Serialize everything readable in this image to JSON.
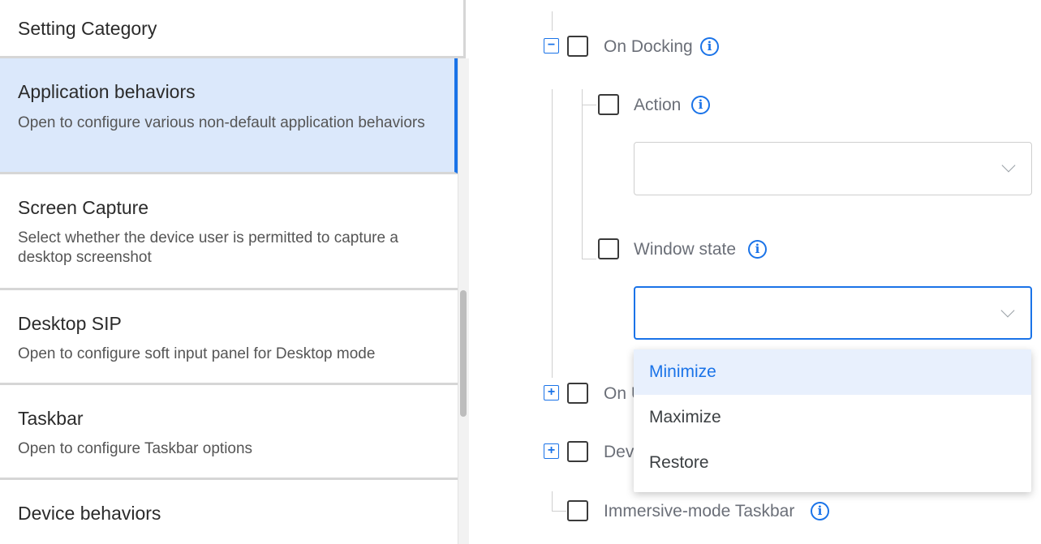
{
  "left_panel": {
    "header": "Setting Category",
    "items": [
      {
        "title": "Application behaviors",
        "description": "Open to configure various non-default application behaviors",
        "selected": true
      },
      {
        "title": "Screen Capture",
        "description": "Select whether the device user is permitted to capture a desktop screenshot",
        "selected": false
      },
      {
        "title": "Desktop SIP",
        "description": "Open to configure soft input panel for Desktop mode",
        "selected": false
      },
      {
        "title": "Taskbar",
        "description": "Open to configure Taskbar options",
        "selected": false
      },
      {
        "title": "Device behaviors",
        "description": "",
        "selected": false
      }
    ]
  },
  "tree": {
    "on_docking": {
      "label": "On Docking",
      "expander": "−",
      "info": "i"
    },
    "action": {
      "label": "Action",
      "info": "i",
      "select_value": ""
    },
    "window_state": {
      "label": "Window state",
      "info": "i",
      "select_value": ""
    },
    "on_undocking": {
      "label": "On U",
      "expander": "+"
    },
    "device": {
      "label": "Dev",
      "expander": "+"
    },
    "immersive": {
      "label": "Immersive-mode Taskbar",
      "info": "i"
    }
  },
  "dropdown": {
    "options": [
      "Minimize",
      "Maximize",
      "Restore"
    ],
    "highlighted": "Minimize"
  },
  "colors": {
    "accent": "#1a73e8",
    "selected_bg": "#dbe8fb",
    "highlight_bg": "#e8f0fd"
  }
}
